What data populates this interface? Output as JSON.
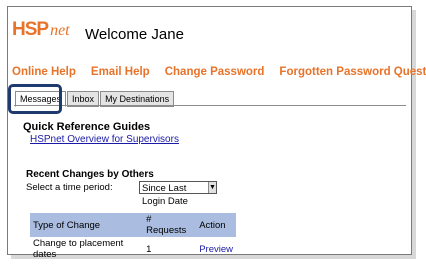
{
  "header": {
    "logo_main": "HSP",
    "logo_suffix": "net",
    "welcome": "Welcome Jane"
  },
  "top_links": [
    "Online Help",
    "Email Help",
    "Change Password",
    "Forgotten Password Question"
  ],
  "tabs": [
    {
      "label": "Messages",
      "active": true
    },
    {
      "label": "Inbox",
      "active": false
    },
    {
      "label": "My Destinations",
      "active": false
    }
  ],
  "quick_ref": {
    "title": "Quick Reference Guides",
    "link": "HSPnet Overview for Supervisors"
  },
  "recent": {
    "title": "Recent Changes by Others",
    "period_label": "Select a time period:",
    "period_value": "Since Last Login Date",
    "table": {
      "headers": [
        "Type of Change",
        "# Requests",
        "Action"
      ],
      "rows": [
        [
          "Change to placement dates",
          "1",
          "Preview"
        ]
      ]
    }
  },
  "colors": {
    "brand_orange": "#e8732a",
    "link_blue": "#1a1aa8",
    "table_header": "#aabde0",
    "highlight_border": "#1e3a6e"
  }
}
